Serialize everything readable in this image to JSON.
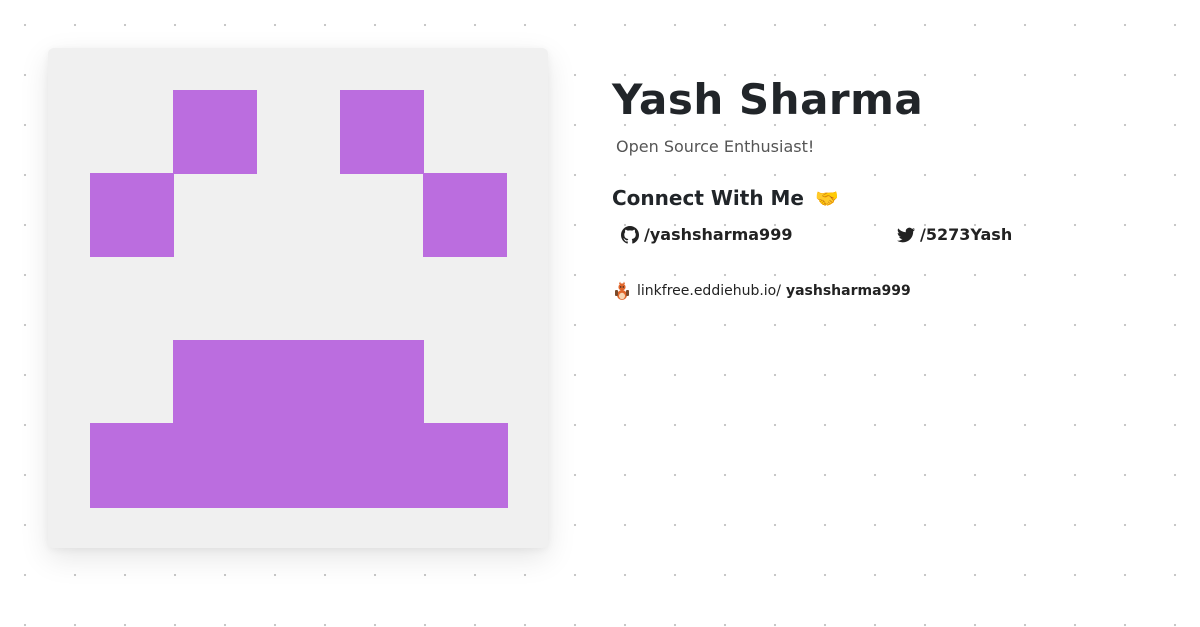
{
  "profile": {
    "name": "Yash Sharma",
    "bio": "Open Source Enthusiast!",
    "avatar_color": "#bb6ddf",
    "avatar_background": "#f0f0f0"
  },
  "connect": {
    "heading": "Connect With Me",
    "emoji": "🤝"
  },
  "socials": [
    {
      "icon": "github-icon",
      "label": "/yashsharma999"
    },
    {
      "icon": "twitter-icon",
      "label": "/5273Yash"
    }
  ],
  "linkfree": {
    "icon": "linkfree-mascot-icon",
    "prefix": "linkfree.eddiehub.io/",
    "username": "yashsharma999"
  }
}
